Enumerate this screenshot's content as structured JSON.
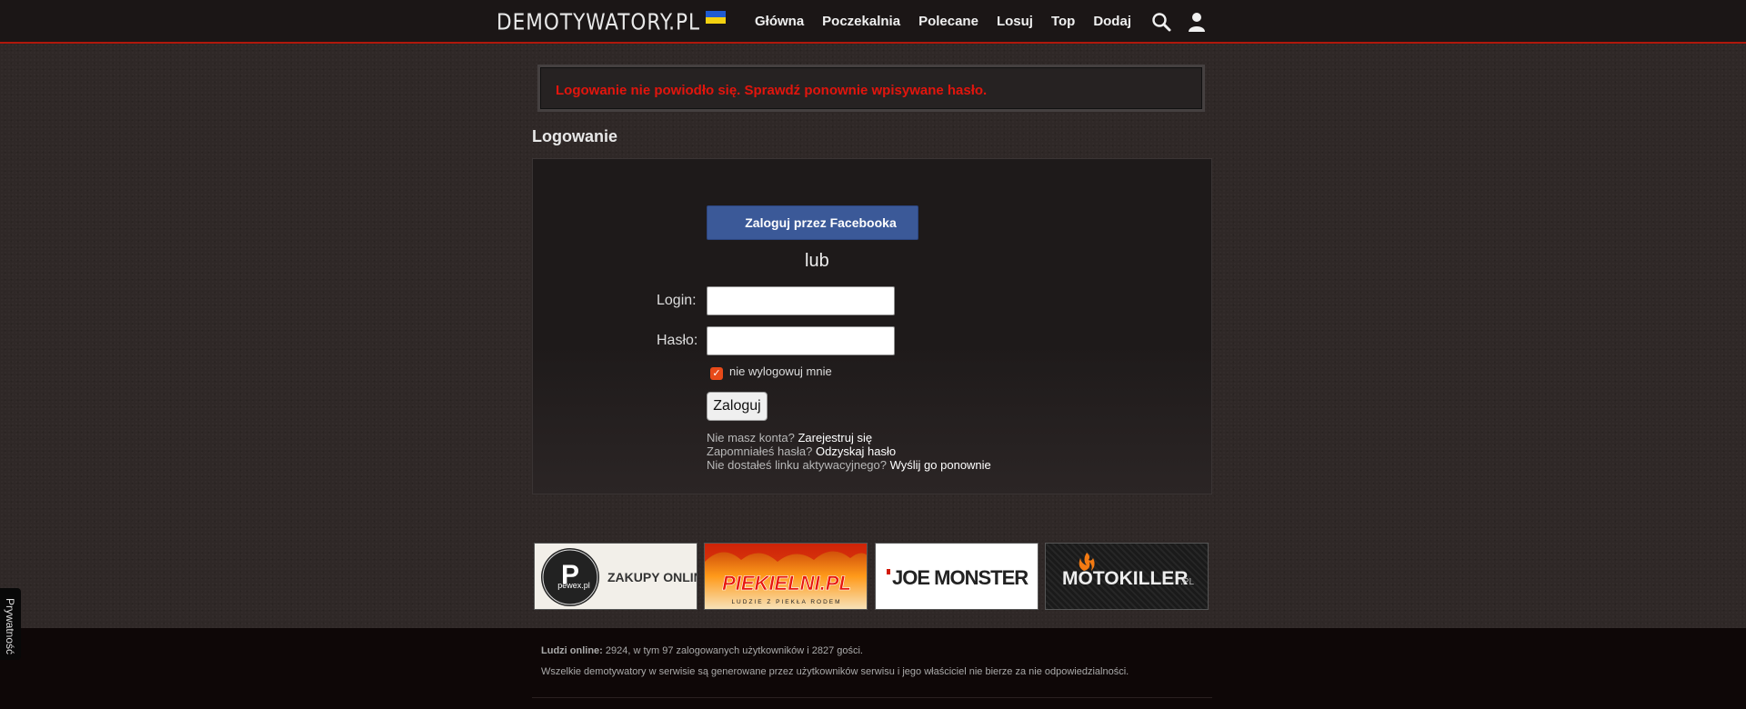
{
  "header": {
    "logo": "DEMOTYWATORY.PL",
    "nav": [
      "Główna",
      "Poczekalnia",
      "Polecane",
      "Losuj",
      "Top",
      "Dodaj"
    ],
    "icons": [
      "search-icon",
      "user-icon"
    ],
    "flag_colors": [
      "#1f5bd0",
      "#f3d110"
    ]
  },
  "error": {
    "message": "Logowanie nie powiodło się. Sprawdź ponownie wpisywane hasło."
  },
  "page": {
    "title": "Logowanie"
  },
  "login": {
    "facebook_button": "Zaloguj przez Facebooka",
    "or": "lub",
    "login_label": "Login:",
    "login_value": "",
    "password_label": "Hasło:",
    "password_value": "",
    "remember_label": "nie wylogowuj mnie",
    "remember_checked": true,
    "submit": "Zaloguj",
    "no_account": "Nie masz konta?",
    "register_link": "Zarejestruj się",
    "forgot": "Zapomniałeś hasła?",
    "recover_link": "Odzyskaj hasło",
    "no_activation": "Nie dostałeś linku aktywacyjnego?",
    "resend_link": "Wyślij go ponownie"
  },
  "partners": [
    {
      "name": "pewex.pl",
      "tagline": "ZAKUPY ONLINE"
    },
    {
      "name": "PIEKIELNI.PL",
      "tagline": "LUDZIE Z PIEKŁA RODEM"
    },
    {
      "name": "JOE MONSTER"
    },
    {
      "name": "MOTOKILLER",
      "suffix": ".PL"
    }
  ],
  "footer": {
    "online_label": "Ludzi online:",
    "online_text": " 2924, w tym 97 zalogowanych użytkowników i 2827 gości.",
    "disclaimer": "Wszelkie demotywatory w serwisie są generowane przez użytkowników serwisu i jego właściciel nie bierze za nie odpowiedzialności."
  },
  "privacy": {
    "label": "Prywatność"
  },
  "colors": {
    "accent": "#b0180c",
    "error": "#e2150d",
    "facebook": "#3b5998",
    "checkbox": "#e74a19"
  }
}
